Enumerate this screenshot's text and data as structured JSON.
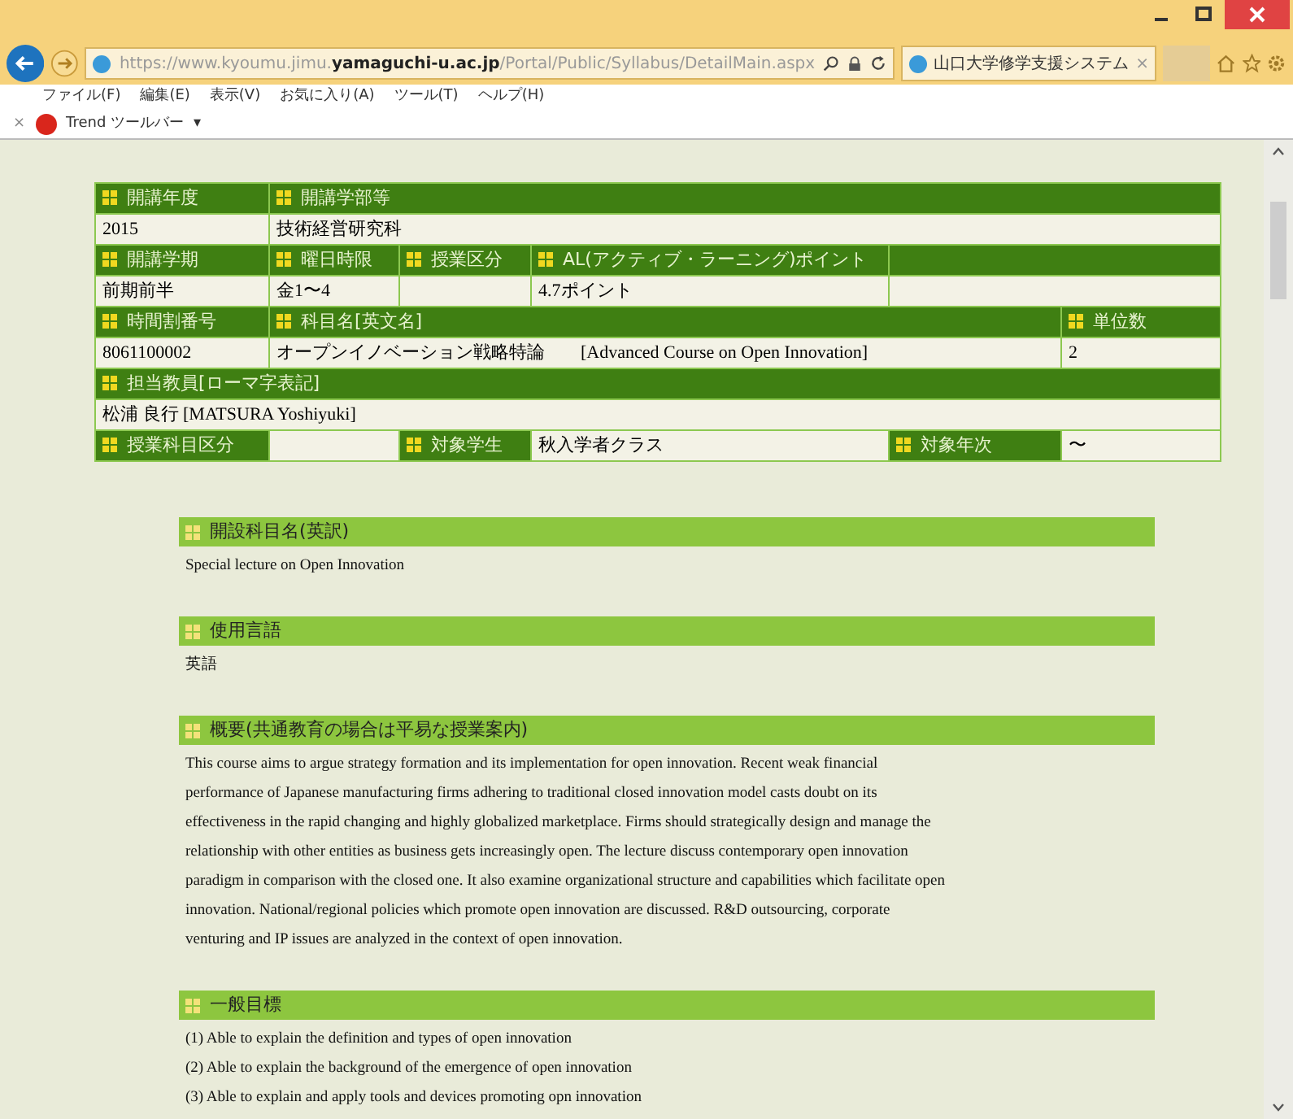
{
  "browser": {
    "url": "https://www.kyoumu.jimu.**yamaguchi-u.ac.jp**/Portal/Public/Syllabus/DetailMain.aspx",
    "tab": {
      "title": "山口大学修学支援システム",
      "close": "×"
    },
    "menu": [
      "ファイル(F)",
      "編集(E)",
      "表示(V)",
      "お気に入り(A)",
      "ツール(T)",
      "ヘルプ(H)"
    ],
    "toolbar": {
      "close": "×",
      "label": "Trend ツールバー",
      "caret": "▾"
    }
  },
  "info_table": [
    [
      {
        "kind": "header",
        "text": "開講年度"
      },
      {
        "kind": "header",
        "text": "開講学部等"
      }
    ],
    [
      {
        "kind": "value",
        "text": "2015"
      },
      {
        "kind": "value",
        "text": "技術経営研究科"
      }
    ],
    [
      {
        "kind": "header",
        "text": "開講学期"
      },
      {
        "kind": "header",
        "text": "曜日時限"
      },
      {
        "kind": "header",
        "text": "授業区分"
      },
      {
        "kind": "header",
        "text": "AL(アクティブ・ラーニング)ポイント"
      },
      {
        "kind": "blank_header"
      }
    ],
    [
      {
        "kind": "value",
        "text": "前期前半"
      },
      {
        "kind": "value",
        "text": "金1〜4"
      },
      {
        "kind": "blank"
      },
      {
        "kind": "value",
        "text": "4.7ポイント"
      },
      {
        "kind": "blank"
      }
    ],
    [
      {
        "kind": "header",
        "text": "時間割番号"
      },
      {
        "kind": "header",
        "text": "科目名[英文名]"
      },
      {
        "kind": "header",
        "text": "単位数"
      }
    ],
    [
      {
        "kind": "value",
        "text": "8061100002"
      },
      {
        "kind": "value",
        "text": "オープンイノベーション戦略特論　　[Advanced Course on Open Innovation]"
      },
      {
        "kind": "value",
        "text": "2"
      }
    ],
    [
      {
        "kind": "header",
        "text": "担当教員[ローマ字表記]"
      }
    ],
    [
      {
        "kind": "value",
        "text": "松浦 良行  [MATSURA Yoshiyuki]"
      }
    ],
    [
      {
        "kind": "header",
        "text": "授業科目区分"
      },
      {
        "kind": "blank"
      },
      {
        "kind": "header",
        "text": "対象学生"
      },
      {
        "kind": "value",
        "text": "秋入学者クラス"
      },
      {
        "kind": "header",
        "text": "対象年次"
      },
      {
        "kind": "value",
        "text": "〜"
      }
    ]
  ],
  "sections": [
    {
      "heading": "開設科目名(英訳)",
      "lines": [
        "Special lecture on Open Innovation"
      ]
    },
    {
      "heading": "使用言語",
      "lines": [
        "英語"
      ]
    },
    {
      "heading": "概要(共通教育の場合は平易な授業案内)",
      "lines": [
        "This course aims to argue strategy formation and its implementation for open innovation. Recent weak financial",
        "performance of Japanese manufacturing firms adhering to traditional closed innovation model casts doubt on its",
        "effectiveness in the rapid changing and highly globalized marketplace. Firms should strategically design and manage the",
        "relationship with other entities as business gets increasingly open. The lecture discuss contemporary open innovation",
        "paradigm in comparison with the closed one. It also examine organizational structure and capabilities which facilitate open",
        "innovation. National/regional policies which promote open innovation are discussed. R&D outsourcing, corporate",
        "venturing and IP issues are analyzed in the context of open innovation."
      ]
    },
    {
      "heading": "一般目標",
      "lines": [
        "(1) Able to explain the definition and types of open innovation",
        "(2) Able to explain the background of the emergence of open innovation",
        "(3) Able to explain and apply tools and devices promoting opn innovation"
      ]
    }
  ]
}
